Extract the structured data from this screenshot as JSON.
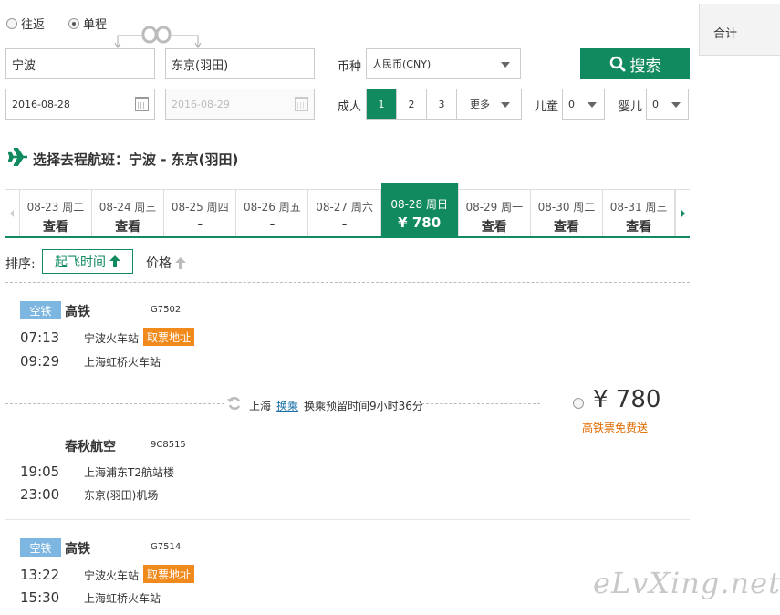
{
  "trip_type": {
    "round_trip": "往返",
    "one_way": "单程",
    "selected": "one_way"
  },
  "route": {
    "from": "宁波",
    "to": "东京(羽田)"
  },
  "dates": {
    "depart": "2016-08-28",
    "return": "2016-08-29"
  },
  "currency": {
    "label": "币种",
    "value": "人民币(CNY)"
  },
  "search": {
    "label": "搜索"
  },
  "total": {
    "label": "合计"
  },
  "passengers": {
    "adult_label": "成人",
    "adult_options": [
      "1",
      "2",
      "3"
    ],
    "more": "更多",
    "child_label": "儿童",
    "child_value": "0",
    "infant_label": "婴儿",
    "infant_value": "0"
  },
  "section_title": "选择去程航班：宁波 - 东京(羽田)",
  "date_strip": [
    {
      "date": "08-23",
      "weekday": "周二",
      "price": "查看"
    },
    {
      "date": "08-24",
      "weekday": "周三",
      "price": "查看"
    },
    {
      "date": "08-25",
      "weekday": "周四",
      "price": "-"
    },
    {
      "date": "08-26",
      "weekday": "周五",
      "price": "-"
    },
    {
      "date": "08-27",
      "weekday": "周六",
      "price": "-"
    },
    {
      "date": "08-28",
      "weekday": "周日",
      "price": "¥ 780"
    },
    {
      "date": "08-29",
      "weekday": "周一",
      "price": "查看"
    },
    {
      "date": "08-30",
      "weekday": "周二",
      "price": "查看"
    },
    {
      "date": "08-31",
      "weekday": "周三",
      "price": "查看"
    }
  ],
  "sort": {
    "label": "排序:",
    "by_time": "起飞时间",
    "by_price": "价格"
  },
  "itinerary1": {
    "leg1": {
      "tag": "空铁",
      "carrier": "高铁",
      "code": "G7502",
      "dep_time": "07:13",
      "dep_station": "宁波火车站",
      "ticket_tag": "取票地址",
      "arr_time": "09:29",
      "arr_station": "上海虹桥火车站"
    },
    "transfer": {
      "city": "上海",
      "link": "换乘",
      "wait": "换乘预留时间9小时36分"
    },
    "leg2": {
      "carrier": "春秋航空",
      "code": "9C8515",
      "dep_time": "19:05",
      "dep_station": "上海浦东T2航站楼",
      "arr_time": "23:00",
      "arr_station": "东京(羽田)机场"
    },
    "price": "¥ 780",
    "note": "高铁票免费送"
  },
  "itinerary2": {
    "leg1": {
      "tag": "空铁",
      "carrier": "高铁",
      "code": "G7514",
      "dep_time": "13:22",
      "dep_station": "宁波火车站",
      "ticket_tag": "取票地址",
      "arr_time": "15:30",
      "arr_station": "上海虹桥火车站"
    }
  },
  "watermark": "eLvXing.net",
  "colors": {
    "brand_green": "#128a5f",
    "orange": "#f08a1c",
    "rail_blue": "#7db6e0"
  }
}
